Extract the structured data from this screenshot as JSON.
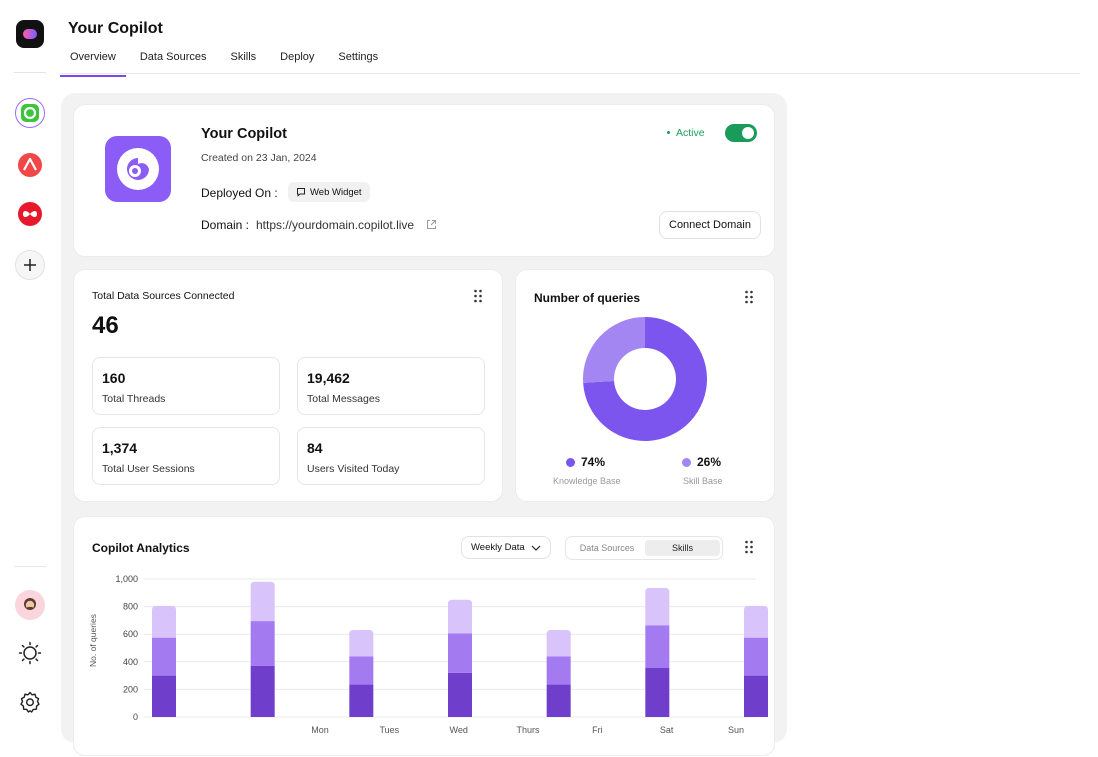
{
  "header": {
    "title": "Your Copilot",
    "tabs": [
      {
        "label": "Overview",
        "active": true
      },
      {
        "label": "Data Sources"
      },
      {
        "label": "Skills"
      },
      {
        "label": "Deploy"
      },
      {
        "label": "Settings"
      }
    ]
  },
  "rail": {
    "apps": [
      {
        "icon": "copilot-green-icon",
        "color": "#3cc43c",
        "selected": true
      },
      {
        "icon": "triangle-red-icon",
        "color": "#f04848"
      },
      {
        "icon": "infinity-red-icon",
        "color": "#e8182c"
      }
    ]
  },
  "copilot": {
    "name": "Your Copilot",
    "created": "Created on 23 Jan, 2024",
    "deployed_label": "Deployed On :",
    "deployed_value": "Web Widget",
    "domain_label": "Domain :",
    "domain_value": "https://yourdomain.copilot.live",
    "status": "Active",
    "connect_button": "Connect Domain",
    "accent": "#8b5cf6",
    "status_color": "#1a9b5a"
  },
  "sources": {
    "title": "Total Data Sources Connected",
    "total": "46",
    "stats": [
      {
        "value": "160",
        "label": "Total Threads"
      },
      {
        "value": "19,462",
        "label": "Total Messages"
      },
      {
        "value": "1,374",
        "label": "Total User Sessions"
      },
      {
        "value": "84",
        "label": "Users Visited Today"
      }
    ]
  },
  "queries": {
    "title": "Number of queries",
    "items": [
      {
        "pct": "74%",
        "label": "Knowledge Base",
        "color": "#7c55ef"
      },
      {
        "pct": "26%",
        "label": "Skill Base",
        "color": "#a486f3"
      }
    ]
  },
  "analytics": {
    "title": "Copilot Analytics",
    "dropdown": "Weekly Data",
    "toggle": [
      "Data Sources",
      "Skills"
    ],
    "toggle_active": "Skills"
  },
  "chart_data": {
    "type": "bar",
    "stacked": true,
    "ylabel": "No. of queries",
    "ylim": [
      0,
      1000
    ],
    "yticks": [
      "1,000",
      "800",
      "600",
      "400",
      "200",
      "0"
    ],
    "xlabels": [
      "Mon",
      "Tues",
      "Wed",
      "Thurs",
      "Fri",
      "Sat",
      "Sun"
    ],
    "bars": 7,
    "series": [
      {
        "values": [
          300,
          370,
          235,
          320,
          235,
          355,
          300
        ],
        "color": "#6f3fcc"
      },
      {
        "values": [
          275,
          325,
          205,
          285,
          205,
          310,
          275
        ],
        "color": "#a37af0"
      },
      {
        "values": [
          230,
          285,
          190,
          245,
          190,
          270,
          230
        ],
        "color": "#d8c4fa"
      }
    ]
  }
}
